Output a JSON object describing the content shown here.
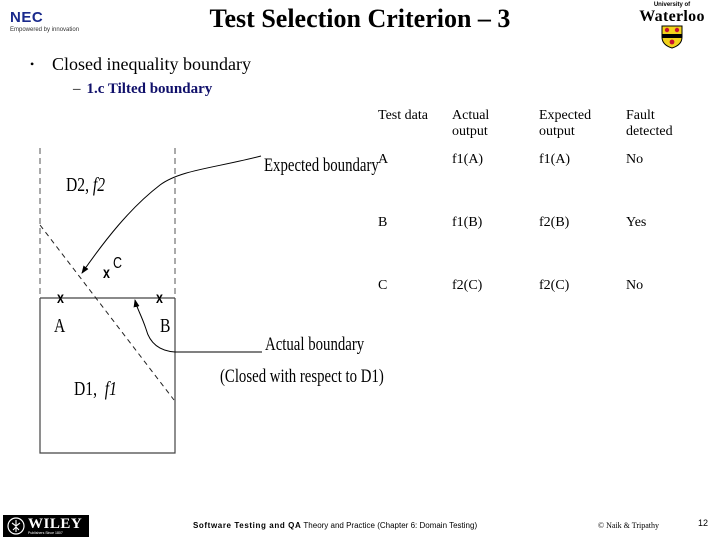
{
  "header": {
    "title": "Test Selection Criterion – 3",
    "left_logo": {
      "brand": "NEC",
      "tagline": "Empowered by innovation",
      "icon": "nec-logo"
    },
    "right_logo": {
      "small_text": "University of",
      "brand": "Waterloo",
      "icon": "waterloo-crest-icon"
    }
  },
  "content": {
    "bullet": "Closed inequality boundary",
    "sub_bullet_dash": "–",
    "sub_bullet": "1.c Tilted boundary"
  },
  "diagram": {
    "region_top_label": "D2,",
    "region_top_func": "f2",
    "region_bottom_label": "D1,",
    "region_bottom_func": "f1",
    "point_labels": {
      "A": "A",
      "B": "B",
      "C": "C"
    },
    "point_marker": "x",
    "expected_boundary_label": "Expected boundary",
    "actual_boundary_label": "Actual boundary",
    "actual_boundary_note": "(Closed with respect to D1)"
  },
  "table": {
    "headers": [
      [
        "Test data",
        ""
      ],
      [
        "Actual",
        "output"
      ],
      [
        "Expected",
        "output"
      ],
      [
        "Fault",
        "detected"
      ]
    ],
    "rows": [
      [
        "A",
        "f1(A)",
        "f1(A)",
        "No"
      ],
      [
        "B",
        "f1(B)",
        "f2(B)",
        "Yes"
      ],
      [
        "C",
        "f2(C)",
        "f2(C)",
        "No"
      ]
    ]
  },
  "footer": {
    "publisher": "WILEY",
    "publisher_tagline": "Publishers Since 1807",
    "book_bold": "Software Testing and QA",
    "book_rest": " Theory and Practice (Chapter 6: Domain Testing)",
    "copyright": "© Naik & Tripathy",
    "page_number": "12"
  }
}
